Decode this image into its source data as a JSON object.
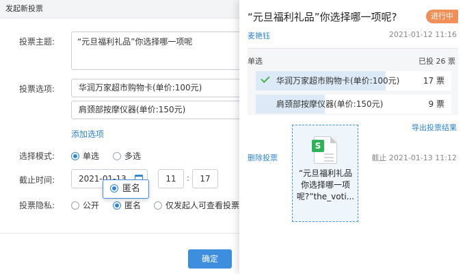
{
  "dialog": {
    "title": "发起新投票",
    "subject_label": "投票主题:",
    "subject_value": "“元旦福利礼品”你选择哪一项呢",
    "options_label": "投票选项:",
    "options": [
      "华润万家超市购物卡(单价:100元)",
      "肩颈部按摩仪器(单价:150元)"
    ],
    "add_option": "添加选项",
    "mode_label": "选择模式:",
    "mode_single": "单选",
    "mode_multi": "多选",
    "deadline_label": "截止时间:",
    "deadline_date": "2021-01-13",
    "deadline_hour": "11",
    "deadline_minute": "17",
    "privacy_label": "投票隐私:",
    "privacy_public": "公开",
    "privacy_anon": "匿名",
    "privacy_initiator": "仅发起人可查看投票成",
    "confirm": "确定"
  },
  "tooltip": {
    "label": "匿名"
  },
  "card": {
    "title": "“元旦福利礼品”你选择哪一项呢?",
    "status": "进行中",
    "author": "麦艳钰",
    "created": "2021-01-12 11:16",
    "mode": "单选",
    "voted": "已投 26 票",
    "results": [
      {
        "label": "华润万家超市购物卡(单价:100元)",
        "count": "17 票",
        "votes": 17,
        "checked": true
      },
      {
        "label": "肩颈部按摩仪器(单价:150元)",
        "count": "9 票",
        "votes": 9,
        "checked": false
      }
    ],
    "export": "导出投票结果",
    "delete": "删除投票",
    "deadline": "截止 2021-01-13 11:12"
  },
  "drag_file": {
    "icon": "spreadsheet-file-icon",
    "icon_letter": "S",
    "name": "“元旦福利礼品你选择哪一项呢?”the_voti..."
  },
  "colors": {
    "accent": "#2f86d6",
    "status": "#f08f57",
    "check": "#4caf50"
  }
}
